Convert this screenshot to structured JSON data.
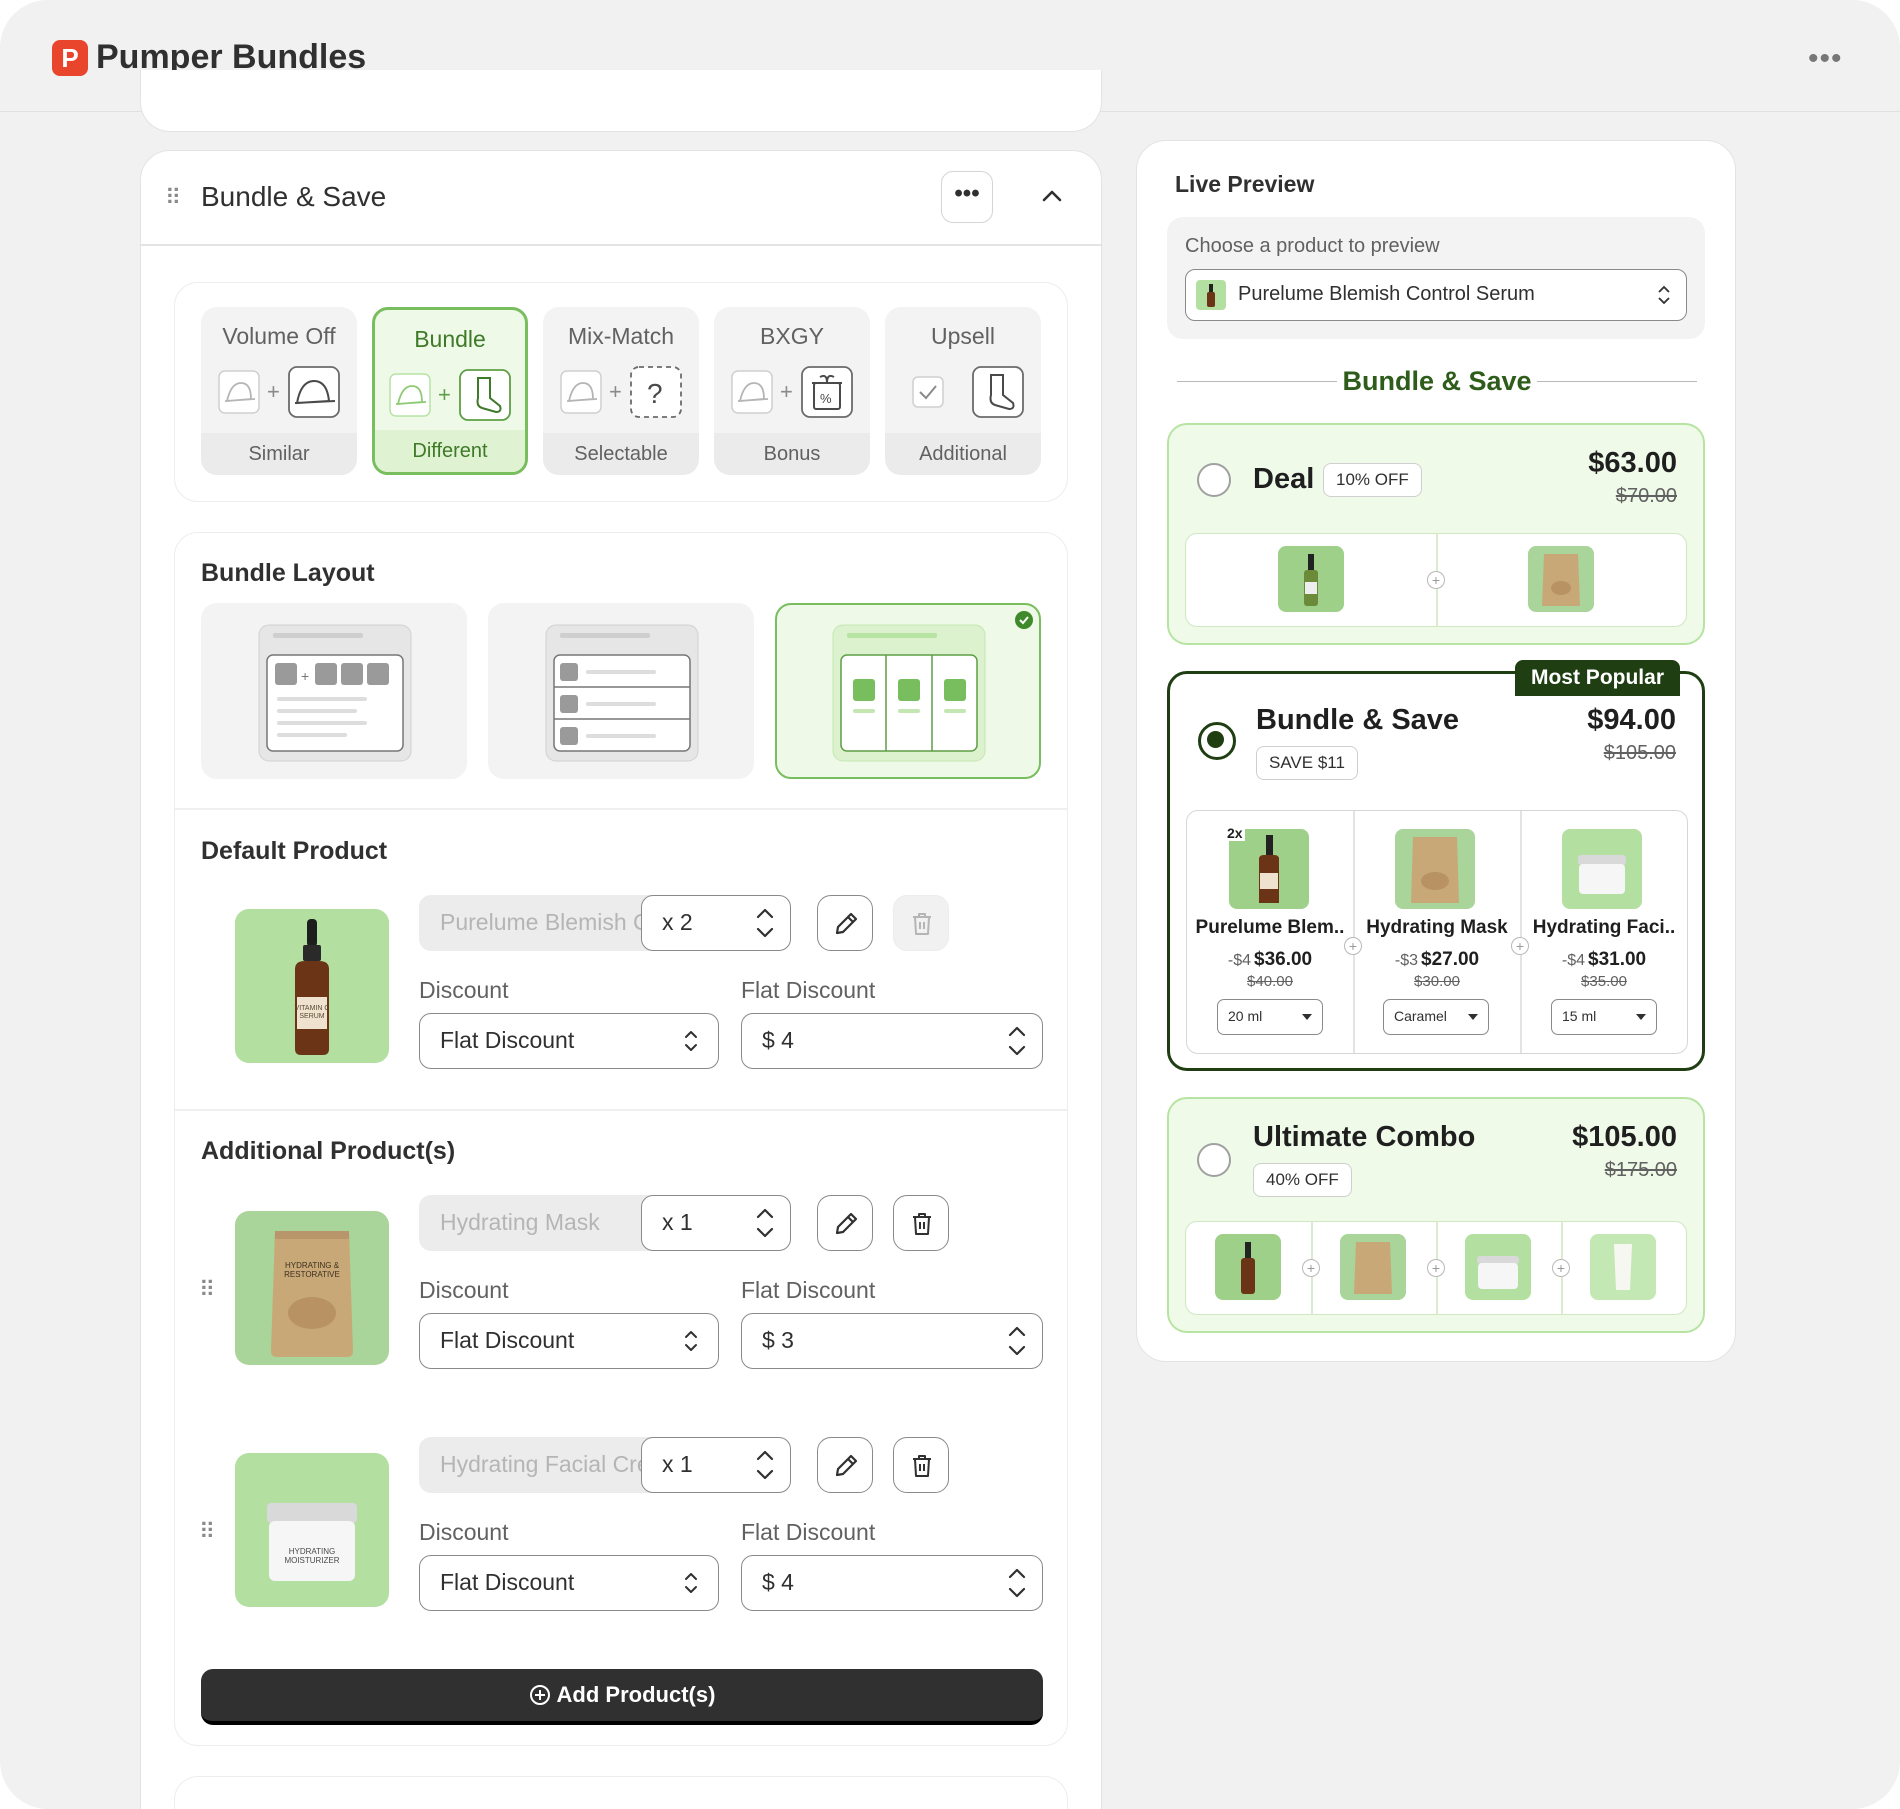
{
  "app": {
    "title": "Pumper Bundles",
    "logo_letter": "P"
  },
  "editor": {
    "section_title": "Bundle & Save",
    "tabs": [
      {
        "title": "Volume Off",
        "subtitle": "Similar"
      },
      {
        "title": "Bundle",
        "subtitle": "Different",
        "selected": true
      },
      {
        "title": "Mix-Match",
        "subtitle": "Selectable"
      },
      {
        "title": "BXGY",
        "subtitle": "Bonus"
      },
      {
        "title": "Upsell",
        "subtitle": "Additional"
      }
    ],
    "layout_title": "Bundle Layout",
    "default_title": "Default Product",
    "additional_title": "Additional Product(s)",
    "discount_label": "Discount",
    "flat_discount_label": "Flat Discount",
    "default_product": {
      "name": "Purelume Blemish Contr..",
      "qty": "x 2",
      "discount_type": "Flat Discount",
      "amount": "$ 4",
      "img_label": "VITAMIN C SERUM"
    },
    "additional_products": [
      {
        "name": "Hydrating Mask",
        "qty": "x 1",
        "discount_type": "Flat Discount",
        "amount": "$ 3",
        "img_label": "HYDRATING & RESTORATIVE"
      },
      {
        "name": "Hydrating Facial Cream",
        "qty": "x 1",
        "discount_type": "Flat Discount",
        "amount": "$ 4",
        "img_label": "HYDRATING MOISTURIZER"
      }
    ],
    "add_button": "Add Product(s)"
  },
  "preview": {
    "title": "Live Preview",
    "choose_label": "Choose a product to preview",
    "selected_product": "Purelume Blemish Control Serum",
    "heading": "Bundle & Save",
    "offers": [
      {
        "name": "Deal",
        "badge": "10% OFF",
        "price": "$63.00",
        "old_price": "$70.00"
      },
      {
        "name": "Bundle & Save",
        "badge": "SAVE $11",
        "price": "$94.00",
        "old_price": "$105.00",
        "ribbon": "Most Popular",
        "items": [
          {
            "name": "Purelume Blem..",
            "qty": "2x",
            "discount": "-$4",
            "price": "$36.00",
            "old": "$40.00",
            "variant": "20 ml"
          },
          {
            "name": "Hydrating Mask",
            "discount": "-$3",
            "price": "$27.00",
            "old": "$30.00",
            "variant": "Caramel"
          },
          {
            "name": "Hydrating Faci..",
            "discount": "-$4",
            "price": "$31.00",
            "old": "$35.00",
            "variant": "15 ml"
          }
        ]
      },
      {
        "name": "Ultimate Combo",
        "badge": "40% OFF",
        "price": "$105.00",
        "old_price": "$175.00"
      }
    ]
  },
  "colors": {
    "accent": "#78bd5e",
    "accent_dark": "#1f3e12",
    "light_green": "#effae8",
    "logo": "#e8452c"
  },
  "icons": [
    "drag-handle-icon",
    "more-icon",
    "chevron-up-icon",
    "chevron-down-icon",
    "pencil-icon",
    "trash-icon",
    "plus-circle-icon",
    "select-arrows-icon"
  ]
}
